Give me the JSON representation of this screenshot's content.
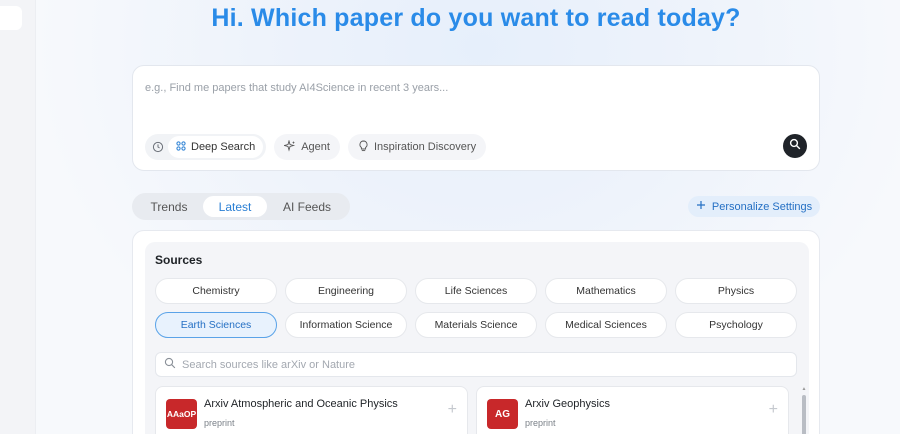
{
  "hero": {
    "title": "Hi. Which paper do you want to read today?"
  },
  "search": {
    "placeholder": "e.g., Find me papers that study AI4Science in recent 3 years...",
    "modes": [
      "Deep Search",
      "Agent",
      "Inspiration Discovery"
    ],
    "icons": {
      "history": "clock-icon",
      "deep_search": "grid-icon",
      "agent": "sparkle-icon",
      "inspiration": "lightbulb-icon",
      "submit": "search-icon"
    }
  },
  "tabs": [
    "Trends",
    "Latest",
    "AI Feeds"
  ],
  "active_tab": "Latest",
  "personalize": {
    "label": "Personalize Settings",
    "icon": "plus-icon"
  },
  "sources": {
    "title": "Sources",
    "categories_row1": [
      "Chemistry",
      "Engineering",
      "Life Sciences",
      "Mathematics",
      "Physics"
    ],
    "categories_row2": [
      "Earth Sciences",
      "Information Science",
      "Materials Science",
      "Medical Sciences",
      "Psychology"
    ],
    "active_category": "Earth Sciences",
    "search_placeholder": "Search sources like arXiv or Nature",
    "items": [
      {
        "logo_text": "AAaOP",
        "name": "Arxiv Atmospheric and Oceanic Physics",
        "type": "preprint"
      },
      {
        "logo_text": "AG",
        "name": "Arxiv Geophysics",
        "type": "preprint"
      }
    ]
  },
  "colors": {
    "accent": "#2a8be8",
    "logo_red": "#c8282a",
    "active_chip_border": "#5aa3e8"
  }
}
